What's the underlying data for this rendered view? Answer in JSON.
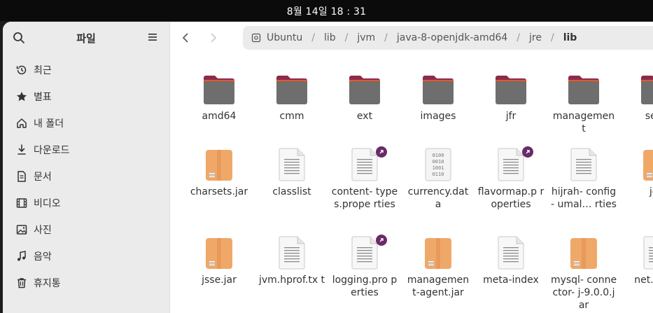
{
  "system": {
    "clock": "8월 14일  18 : 31"
  },
  "sidebar": {
    "title": "파일",
    "items": [
      {
        "label": "최근",
        "icon": "recent-icon"
      },
      {
        "label": "별표",
        "icon": "star-icon"
      },
      {
        "label": "내 폴더",
        "icon": "home-icon"
      },
      {
        "label": "다운로드",
        "icon": "download-icon"
      },
      {
        "label": "문서",
        "icon": "document-icon"
      },
      {
        "label": "비디오",
        "icon": "video-icon"
      },
      {
        "label": "사진",
        "icon": "picture-icon"
      },
      {
        "label": "음악",
        "icon": "music-icon"
      },
      {
        "label": "휴지통",
        "icon": "trash-icon"
      }
    ]
  },
  "path": [
    "Ubuntu",
    "lib",
    "jvm",
    "java-8-openjdk-amd64",
    "jre",
    "lib"
  ],
  "files": [
    {
      "name": "amd64",
      "kind": "folder"
    },
    {
      "name": "cmm",
      "kind": "folder"
    },
    {
      "name": "ext",
      "kind": "folder"
    },
    {
      "name": "images",
      "kind": "folder"
    },
    {
      "name": "jfr",
      "kind": "folder"
    },
    {
      "name": "managemen t",
      "kind": "folder"
    },
    {
      "name": "secu",
      "kind": "folder"
    },
    {
      "name": "charsets.jar",
      "kind": "jar"
    },
    {
      "name": "classlist",
      "kind": "text"
    },
    {
      "name": "content- types.prope rties",
      "kind": "text",
      "link": true
    },
    {
      "name": "currency.dat a",
      "kind": "binary"
    },
    {
      "name": "flavormap.p roperties",
      "kind": "text",
      "link": true
    },
    {
      "name": "hijrah- config- umal… rties",
      "kind": "text"
    },
    {
      "name": "jce",
      "kind": "jar"
    },
    {
      "name": "jsse.jar",
      "kind": "jar"
    },
    {
      "name": "jvm.hprof.tx t",
      "kind": "text"
    },
    {
      "name": "logging.pro perties",
      "kind": "text",
      "link": true
    },
    {
      "name": "managemen t-agent.jar",
      "kind": "jar"
    },
    {
      "name": "meta-index",
      "kind": "text"
    },
    {
      "name": "mysql- connector- j-9.0.0.jar",
      "kind": "jar"
    },
    {
      "name": "net.pro e",
      "kind": "text"
    }
  ],
  "colors": {
    "folder": "#6e6e6e",
    "folder_tab": "#8d2a4a",
    "folder_edge": "#e2572e",
    "jar": "#f0a868",
    "link_badge": "#6b2a6a"
  }
}
